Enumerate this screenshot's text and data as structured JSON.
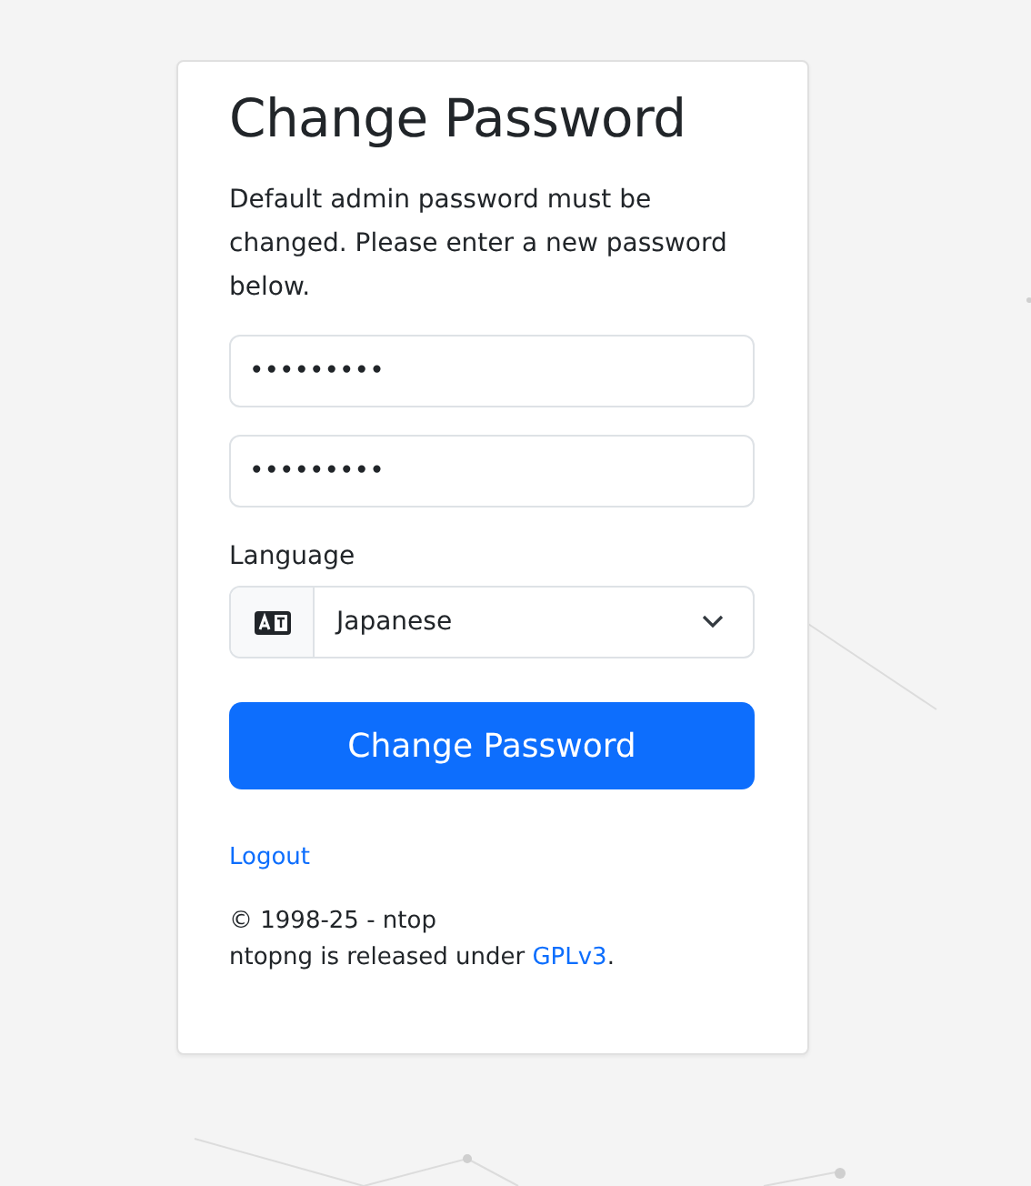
{
  "title": "Change Password",
  "message": "Default admin password must be changed. Please enter a new password below.",
  "password_fields": [
    {
      "value": "•••••••••"
    },
    {
      "value": "•••••••••"
    }
  ],
  "language": {
    "label": "Language",
    "value": "Japanese"
  },
  "submit_button": "Change Password",
  "logout_link": "Logout",
  "footer": {
    "copyright": "© 1998-25 - ntop",
    "license_text": "ntopng is released under ",
    "license_link": "GPLv3",
    "license_end": "."
  }
}
